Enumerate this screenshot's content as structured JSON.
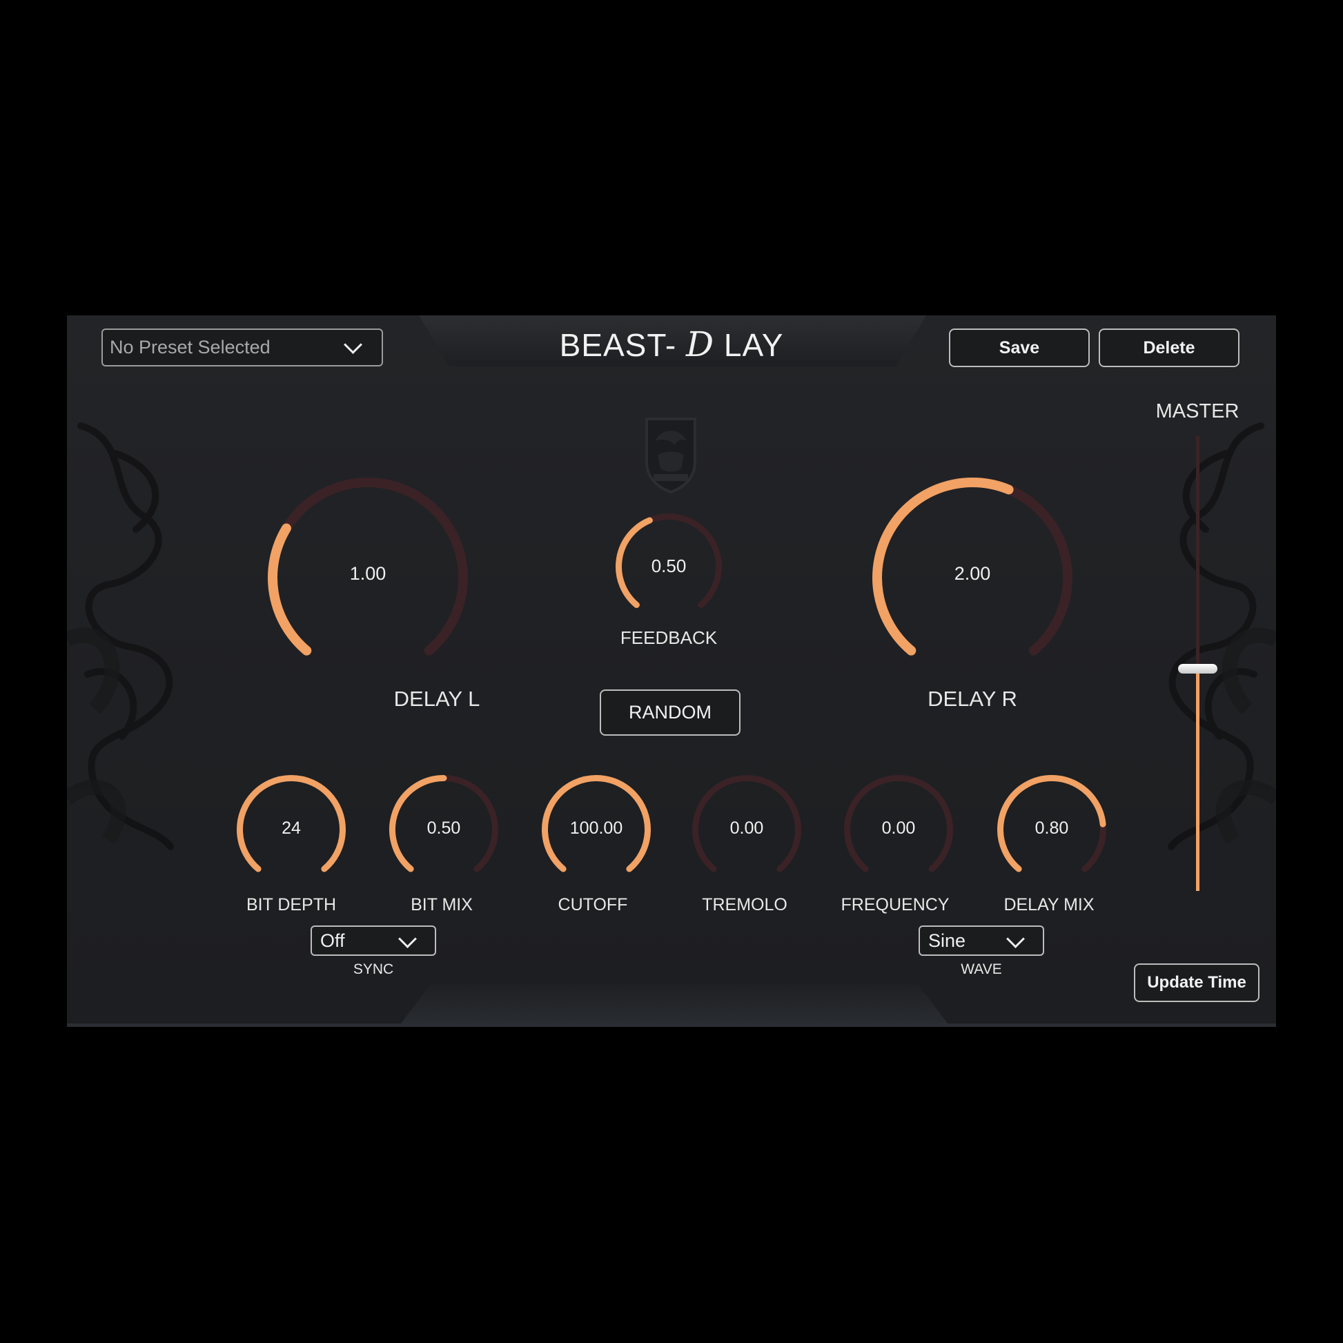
{
  "preset": {
    "selected": "No Preset Selected"
  },
  "title": {
    "prefix": "BEAST-",
    "stylized": "D",
    "suffix": "LAY"
  },
  "buttons": {
    "save": "Save",
    "delete": "Delete",
    "random": "RANDOM",
    "update_time": "Update Time"
  },
  "master": {
    "label": "MASTER",
    "level": 0.49
  },
  "knobs": {
    "delay_l": {
      "label": "DELAY L",
      "value": "1.00",
      "fraction": 0.29
    },
    "feedback": {
      "label": "FEEDBACK",
      "value": "0.50",
      "fraction": 0.42
    },
    "delay_r": {
      "label": "DELAY R",
      "value": "2.00",
      "fraction": 0.58
    },
    "bit_depth": {
      "label": "BIT DEPTH",
      "value": "24",
      "fraction": 1.0
    },
    "bit_mix": {
      "label": "BIT MIX",
      "value": "0.50",
      "fraction": 0.5
    },
    "cutoff": {
      "label": "CUTOFF",
      "value": "100.00",
      "fraction": 1.0
    },
    "tremolo": {
      "label": "TREMOLO",
      "value": "0.00",
      "fraction": 0.0
    },
    "frequency": {
      "label": "FREQUENCY",
      "value": "0.00",
      "fraction": 0.0
    },
    "delay_mix": {
      "label": "DELAY MIX",
      "value": "0.80",
      "fraction": 0.8
    }
  },
  "sync": {
    "label": "SYNC",
    "selected": "Off"
  },
  "wave": {
    "label": "WAVE",
    "selected": "Sine"
  },
  "colors": {
    "accent": "#f1a264",
    "track": "#3a2226",
    "background": "#202124"
  }
}
